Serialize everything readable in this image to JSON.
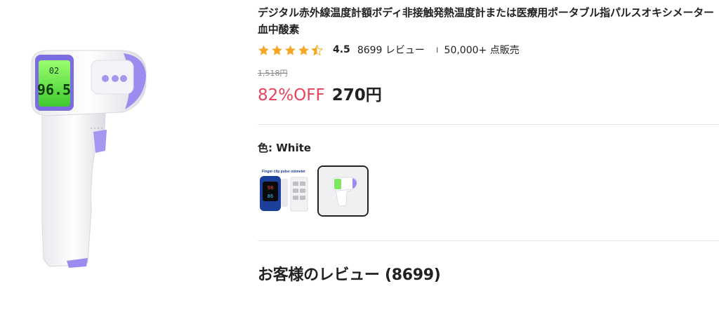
{
  "product": {
    "title": "デジタル赤外線温度計額ボディ非接触発熱温度計または医療用ポータブル指パルスオキシメーター血中酸素",
    "rating": {
      "value": "4.5",
      "stars": 4.5,
      "reviews": "8699 レビュー",
      "separator": "ı",
      "sold": "50,000+ 点販売"
    },
    "original_price": "1,518円",
    "discount": "82%OFF",
    "price": "270円",
    "colors": {
      "label": "色: White",
      "options": [
        "oximeter",
        "thermometer"
      ],
      "selected_index": 1
    },
    "thermometer_display": {
      "top": "02",
      "main": "96.5"
    },
    "oximeter_box_label": "Finger clip pulse oximeter"
  },
  "reviews": {
    "heading": "お客様のレビュー (8699)"
  },
  "colors": {
    "star": "#f5a623",
    "discount": "#e8425c",
    "device_purple": "#9d8cf0",
    "screen_green": "#7dff5a"
  }
}
